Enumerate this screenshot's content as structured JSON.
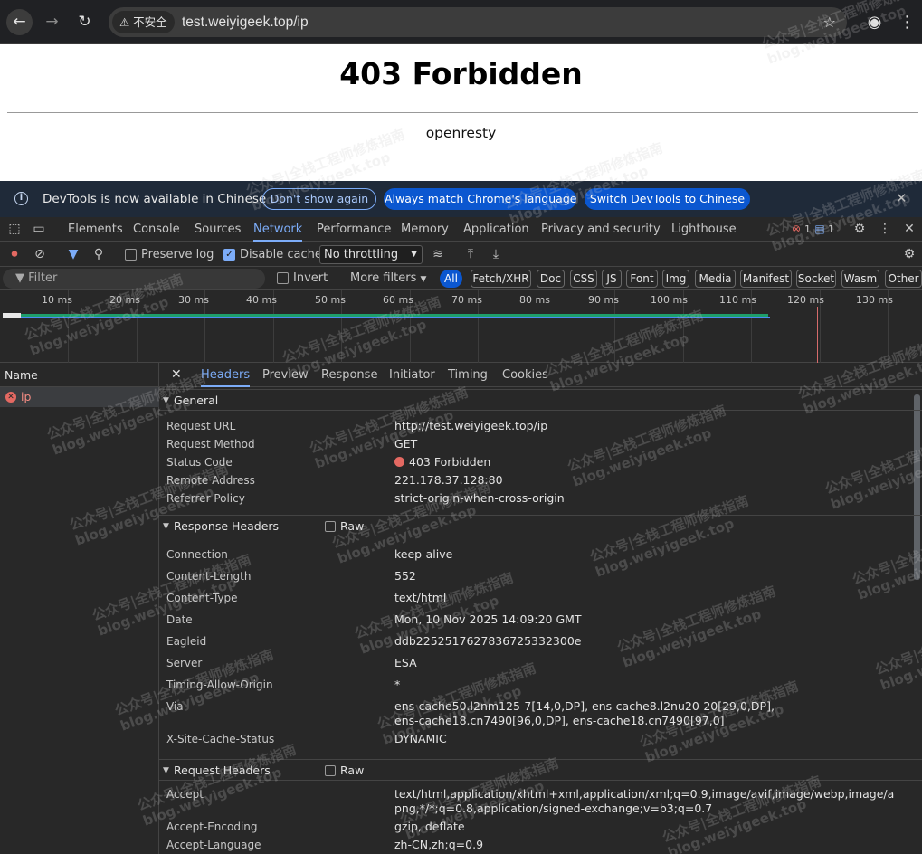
{
  "browser": {
    "security_label": "⚠ 不安全",
    "url": "test.weiyigeek.top/ip"
  },
  "page": {
    "title": "403 Forbidden",
    "server": "openresty"
  },
  "devtools": {
    "infobar": {
      "text": "DevTools is now available in Chinese",
      "btn_dont_show": "Don't show again",
      "btn_match": "Always match Chrome's language",
      "btn_switch": "Switch DevTools to Chinese"
    },
    "tabs": [
      "Elements",
      "Console",
      "Sources",
      "Network",
      "Performance",
      "Memory",
      "Application",
      "Privacy and security",
      "Lighthouse"
    ],
    "error_count": "1",
    "message_count": "1",
    "controls": {
      "preserve_log": "Preserve log",
      "disable_cache": "Disable cache",
      "throttling": "No throttling"
    },
    "filter": {
      "placeholder": "Filter",
      "invert": "Invert",
      "more_filters": "More filters",
      "chips": [
        "All",
        "Fetch/XHR",
        "Doc",
        "CSS",
        "JS",
        "Font",
        "Img",
        "Media",
        "Manifest",
        "Socket",
        "Wasm",
        "Other"
      ]
    },
    "timeline_ticks": [
      "10 ms",
      "20 ms",
      "30 ms",
      "40 ms",
      "50 ms",
      "60 ms",
      "70 ms",
      "80 ms",
      "90 ms",
      "100 ms",
      "110 ms",
      "120 ms",
      "130 ms"
    ],
    "requests": {
      "header": "Name",
      "items": [
        "ip"
      ]
    },
    "detail_tabs": [
      "Headers",
      "Preview",
      "Response",
      "Initiator",
      "Timing",
      "Cookies"
    ],
    "general": {
      "title": "General",
      "rows": [
        {
          "k": "Request URL",
          "v": "http://test.weiyigeek.top/ip"
        },
        {
          "k": "Request Method",
          "v": "GET"
        },
        {
          "k": "Status Code",
          "v": "403 Forbidden"
        },
        {
          "k": "Remote Address",
          "v": "221.178.37.128:80"
        },
        {
          "k": "Referrer Policy",
          "v": "strict-origin-when-cross-origin"
        }
      ]
    },
    "response_headers": {
      "title": "Response Headers",
      "raw": "Raw",
      "rows": [
        {
          "k": "Connection",
          "v": "keep-alive"
        },
        {
          "k": "Content-Length",
          "v": "552"
        },
        {
          "k": "Content-Type",
          "v": "text/html"
        },
        {
          "k": "Date",
          "v": "Mon, 10 Nov 2025 14:09:20 GMT"
        },
        {
          "k": "Eagleid",
          "v": "ddb2252517627836725332300e"
        },
        {
          "k": "Server",
          "v": "ESA"
        },
        {
          "k": "Timing-Allow-Origin",
          "v": "*"
        },
        {
          "k": "Via",
          "v": "ens-cache50.l2nm125-7[14,0,DP], ens-cache8.l2nu20-20[29,0,DP], ens-cache18.cn7490[96,0,DP], ens-cache18.cn7490[97,0]"
        },
        {
          "k": "X-Site-Cache-Status",
          "v": "DYNAMIC"
        }
      ]
    },
    "request_headers": {
      "title": "Request Headers",
      "raw": "Raw",
      "rows": [
        {
          "k": "Accept",
          "v": "text/html,application/xhtml+xml,application/xml;q=0.9,image/avif,image/webp,image/apng,*/*;q=0.8,application/signed-exchange;v=b3;q=0.7"
        },
        {
          "k": "Accept-Encoding",
          "v": "gzip, deflate"
        },
        {
          "k": "Accept-Language",
          "v": "zh-CN,zh;q=0.9"
        }
      ]
    }
  },
  "watermark": {
    "line1": "公众号|全栈工程师修炼指南",
    "line2": "blog.weiyigeek.top"
  },
  "colors": {
    "accent": "#7cacf8",
    "error": "#e46962",
    "devtools_bg": "#282828"
  }
}
